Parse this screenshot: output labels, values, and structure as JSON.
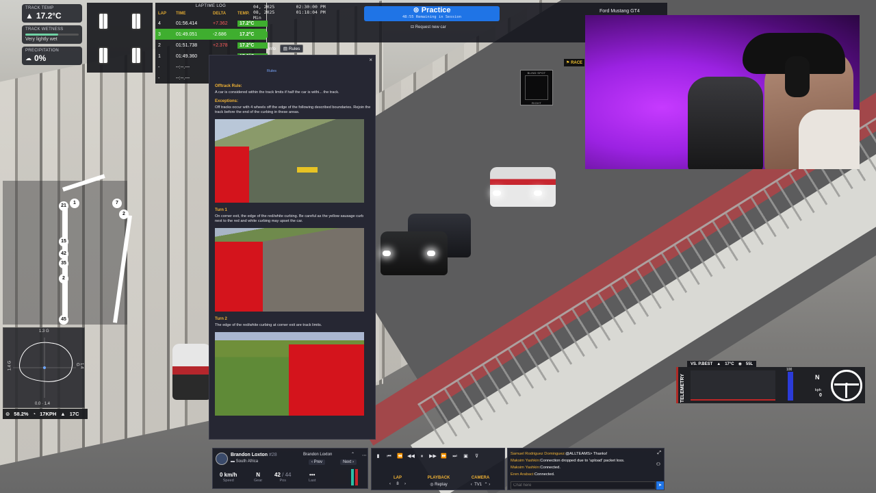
{
  "weather": {
    "track_temp_label": "TRACK TEMP",
    "track_temp_value": "17.2°C",
    "wetness_label": "TRACK WETNESS",
    "wetness_value": "Very lightly wet",
    "wetness_level": 0.62,
    "precip_label": "PRECIPITATION",
    "precip_value": "0%"
  },
  "laptime_log": {
    "title": "LAPTIME LOG",
    "headers": [
      "LAP",
      "TIME",
      "DELTA",
      "TEMP."
    ],
    "rows": [
      {
        "lap": "4",
        "time": "01:56.414",
        "delta": "+7.362",
        "temp": "17.2°C",
        "best": false,
        "delta_positive": true
      },
      {
        "lap": "3",
        "time": "01:49.051",
        "delta": "-2.686",
        "temp": "17.2°C",
        "best": true,
        "delta_positive": false
      },
      {
        "lap": "2",
        "time": "01:51.738",
        "delta": "+2.378",
        "temp": "17.2°C",
        "best": false,
        "delta_positive": true
      },
      {
        "lap": "1",
        "time": "01:49.360",
        "delta": "",
        "temp": "17.2°C",
        "best": false,
        "delta_positive": false
      },
      {
        "lap": "-",
        "time": "--:--.---",
        "delta": "",
        "temp": "",
        "best": false,
        "delta_positive": false
      },
      {
        "lap": "-",
        "time": "--:--.---",
        "delta": "",
        "temp": "",
        "best": false,
        "delta_positive": false
      }
    ]
  },
  "session_times": {
    "line1_date": "04, 2025",
    "line1_time": "02:30:00 PM",
    "line2_date": "08, 2025",
    "line2_time": "01:18:04 PM",
    "line3": "Min"
  },
  "header": {
    "practice_label": "Practice",
    "practice_sub": "48:55 Remaining in Session",
    "request_car": "Request new car",
    "car_name": "Ford Mustang GT4",
    "info_tab": "Info",
    "rules_tab": "Rules",
    "race_chip": "RACE"
  },
  "rules": {
    "tab_label": "Rules",
    "offtrack_title": "Offtrack Rule:",
    "offtrack_text": "A car is considered within the track limits if half the car is withi... the track.",
    "exceptions_title": "Exceptions:",
    "exceptions_text": "Off tracks occur with 4 wheels off the edge of the following described boundaries. Rejoin the track before the end of the curbing in these areas.",
    "turn1_title": "Turn 1",
    "turn1_text": "On corner exit, the edge of the red/white curbing. Be careful as the yellow sausage curb next to the red and white curbing may upset the car.",
    "turn2_title": "Turn 2",
    "turn2_text": "The edge of the red/white curbing at corner exit are track limits.",
    "close_glyph": "×"
  },
  "blind_spot": {
    "title": "BLIND SPOT",
    "left_label": "LEFT",
    "right_label": "RIGHT"
  },
  "trackmap": {
    "nodes": [
      "21",
      "1",
      "7",
      "2",
      "15",
      "42",
      "35",
      "2",
      "45"
    ]
  },
  "gforce": {
    "top": "1.3 G",
    "left": "1.4 G",
    "right": "1.4 G",
    "bottom": "0.0 · 1.4"
  },
  "bottom_stats": {
    "fuel": "58.2%",
    "speed": "17KPH",
    "temp": "17C"
  },
  "driver": {
    "name": "Brandon Loxton",
    "number": "#28",
    "country": "South Africa",
    "selector": "Brandon Loxton",
    "prev": "‹ Prev",
    "next": "Next ›",
    "speed_value": "0 km/h",
    "speed_label": "Speed",
    "gear_value": "N",
    "gear_label": "Gear",
    "pos_value": "42",
    "pos_total": "/ 44",
    "pos_label": "Pos",
    "last_value": "•••",
    "last_label": "Last"
  },
  "replay": {
    "lap_label": "LAP",
    "lap_value": "8",
    "playback_label": "PLAYBACK",
    "playback_value": "Replay",
    "camera_label": "CAMERA",
    "camera_value": "TV1"
  },
  "chat": {
    "lines": [
      {
        "name": "Samuel Rodriguez Dominguez:",
        "text": "@ALLTEAMS> Thanks!"
      },
      {
        "name": "Maksim Yashkin:",
        "text": "Connection dropped due to 'upload' packet loss."
      },
      {
        "name": "Maksim Yashkin:",
        "text": "Connected."
      },
      {
        "name": "Eren Arabaci:",
        "text": "Connected."
      }
    ],
    "placeholder": "Chat here"
  },
  "telemetry": {
    "label": "TELEMETRY",
    "vs": "VS. P.BEST",
    "temp": "17°C",
    "fuel": "55L",
    "throttle_value": "100",
    "throttle_level": 1.0,
    "gear": "N",
    "speed_unit": "kph",
    "speed": "0"
  },
  "colors": {
    "accent_blue": "#1f74e6",
    "best_lap_green": "#3fae2f",
    "header_amber": "#e0a932",
    "webcam_purple": "#b22cf0"
  }
}
